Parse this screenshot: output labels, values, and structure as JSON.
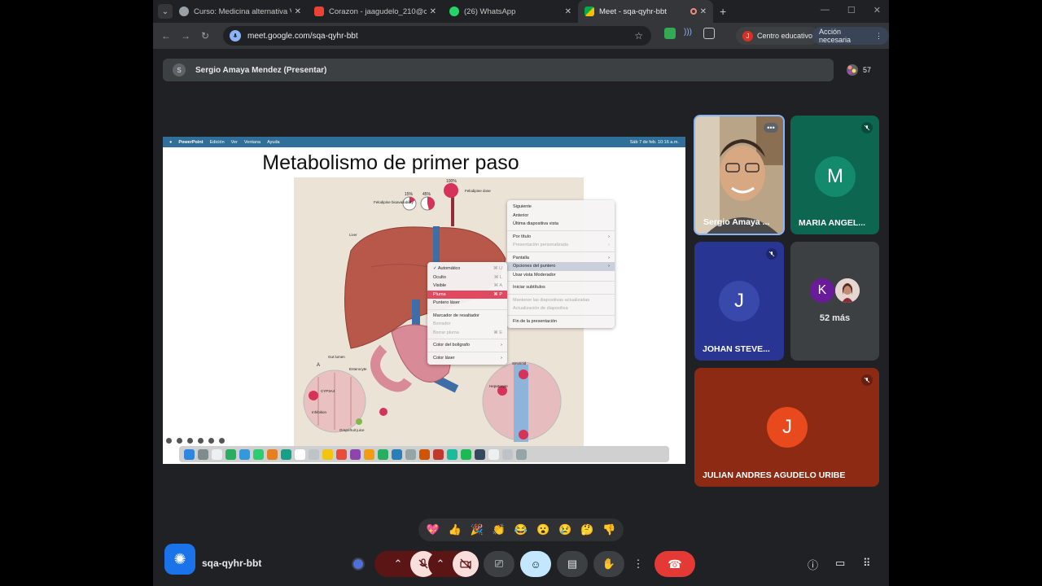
{
  "browser": {
    "tabs": [
      {
        "title": "Curso: Medicina alternativa V -",
        "favicon_color": "#9aa0a6",
        "active": false
      },
      {
        "title": "Corazon - jaagudelo_210@cue",
        "favicon_color": "#ea4335",
        "active": false
      },
      {
        "title": "(26) WhatsApp",
        "favicon_color": "#25d366",
        "active": false
      },
      {
        "title": "Meet - sqa-qyhr-bbt",
        "favicon_color": "#00ac47",
        "active": true
      }
    ],
    "url": "meet.google.com/sqa-qyhr-bbt",
    "profile_label": "Centro educativo",
    "profile_initial": "J",
    "action_label": "Acción necesaria"
  },
  "meet": {
    "presenter_initial": "S",
    "presenter_label": "Sergio Amaya Mendez (Presentar)",
    "participant_count": "57",
    "meeting_code": "sqa-qyhr-bbt"
  },
  "slide": {
    "menubar": {
      "app": "PowerPoint",
      "items": [
        "Edición",
        "Ver",
        "Ventana",
        "Ayuda"
      ],
      "clock": "Sáb 7 de feb.  10:16 a.m."
    },
    "title": "Metabolismo de primer paso",
    "figure_labels": {
      "dose_percent": "100%",
      "dose_label": "Felodipine dose",
      "pct_15": "15%",
      "pct_45": "45%",
      "bioavailability_label": "Felodipine bioavailability",
      "liver_label": "Liver",
      "gut_lumen": "Gut lumen",
      "enterocyte": "Enterocyte",
      "cyp3a4": "CYP3A4",
      "inhibition": "Inhibition",
      "grapefruit_juice": "Grapefruit juice",
      "label_a": "A",
      "sinusoid": "Sinusoid",
      "hepatocyte": "Hepatocyte"
    },
    "context_menu": [
      {
        "label": "Siguiente",
        "disabled": false
      },
      {
        "label": "Anterior",
        "disabled": false
      },
      {
        "label": "Última diapositiva vista",
        "disabled": false
      },
      {
        "sep": true
      },
      {
        "label": "Por título",
        "disabled": false,
        "submenu": true
      },
      {
        "label": "Presentación personalizada",
        "disabled": true,
        "submenu": true
      },
      {
        "sep": true
      },
      {
        "label": "Pantalla",
        "disabled": false,
        "submenu": true
      },
      {
        "label": "Opciones del puntero",
        "disabled": false,
        "submenu": true,
        "selected": true
      },
      {
        "label": "Usar vista Moderador",
        "disabled": false
      },
      {
        "sep": true
      },
      {
        "label": "Iniciar subtítulos",
        "disabled": false
      },
      {
        "sep": true
      },
      {
        "label": "Mantener las diapositivas actualizadas",
        "disabled": true
      },
      {
        "label": "Actualización de diapositiva",
        "disabled": true
      },
      {
        "sep": true
      },
      {
        "label": "Fin de la presentación",
        "disabled": false
      }
    ],
    "pointer_submenu": [
      {
        "label": "✓ Automático",
        "shortcut": "⌘ U"
      },
      {
        "label": "Oculto",
        "shortcut": "⌘ L"
      },
      {
        "label": "Visible",
        "shortcut": "⌘ A"
      },
      {
        "label": "Pluma",
        "shortcut": "⌘ P",
        "highlight": true
      },
      {
        "label": "Puntero láser",
        "shortcut": ""
      },
      {
        "sep": true
      },
      {
        "label": "Marcador de resaltador",
        "shortcut": ""
      },
      {
        "label": "Borrador",
        "shortcut": "",
        "disabled": true
      },
      {
        "label": "Borrar pluma",
        "shortcut": "⌘ E",
        "disabled": true
      },
      {
        "sep": true
      },
      {
        "label": "Color del bolígrafo",
        "shortcut": "",
        "submenu": true
      },
      {
        "sep": true
      },
      {
        "label": "Color láser",
        "shortcut": "",
        "submenu": true
      }
    ]
  },
  "participants": [
    {
      "name": "Sergio Amaya ...",
      "type": "video",
      "border": "#8ab4f8"
    },
    {
      "name": "MARIA ANGEL...",
      "initial": "M",
      "bg": "#0d6650",
      "avatar": "#138a6b",
      "muted": true
    },
    {
      "name": "JOHAN STEVE...",
      "initial": "J",
      "bg": "#283593",
      "avatar": "#3949ab",
      "muted": true
    },
    {
      "name": "52 más",
      "initial": "K",
      "bg": "#3c4043",
      "avatar": "#6a1b9a",
      "muted": false
    },
    {
      "name": "JULIAN ANDRES AGUDELO URIBE",
      "initial": "J",
      "bg": "#8d2a14",
      "avatar": "#e8491d",
      "muted": true
    }
  ],
  "reactions": [
    "💖",
    "👍",
    "🎉",
    "👏",
    "😂",
    "😮",
    "😢",
    "🤔",
    "👎"
  ],
  "colors": {
    "end_call": "#e53935",
    "muted_control": "#f9dedc",
    "active_control": "#c2e7ff",
    "accent": "#1a73e8"
  }
}
